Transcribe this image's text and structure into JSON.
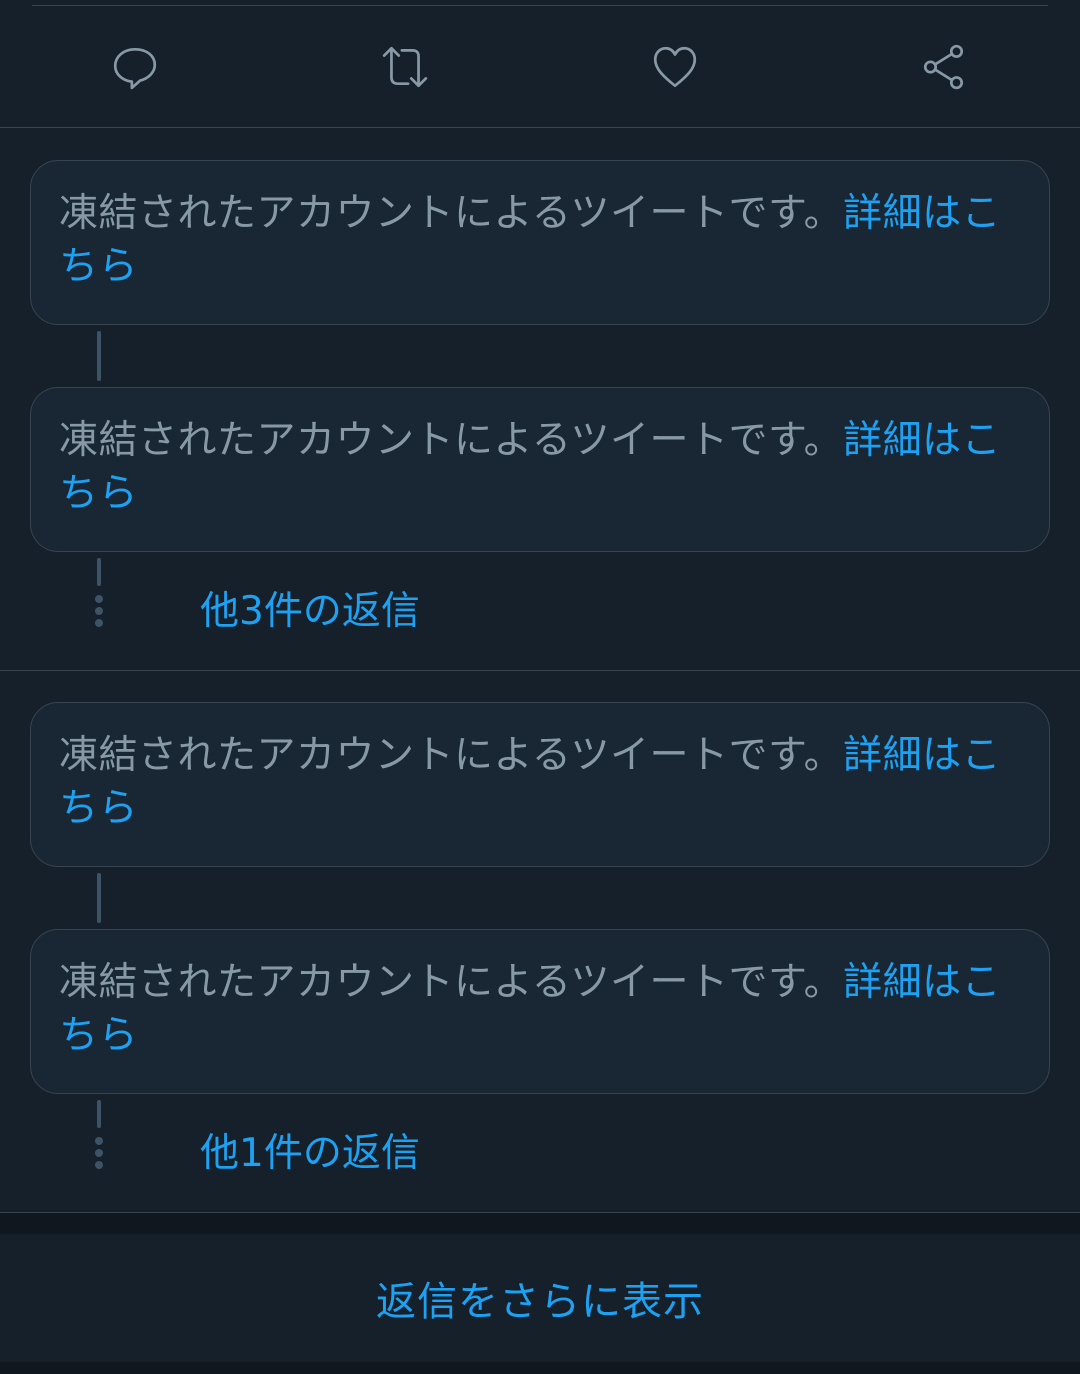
{
  "actions": {
    "reply_icon": "speech-bubble-icon",
    "retweet_icon": "retweet-icon",
    "like_icon": "heart-icon",
    "share_icon": "share-icon"
  },
  "threads": [
    {
      "replies": [
        {
          "message": "凍結されたアカウントによるツイートです。",
          "link": "詳細はこちら"
        },
        {
          "message": "凍結されたアカウントによるツイートです。",
          "link": "詳細はこちら"
        }
      ],
      "more_label": "他3件の返信"
    },
    {
      "replies": [
        {
          "message": "凍結されたアカウントによるツイートです。",
          "link": "詳細はこちら"
        },
        {
          "message": "凍結されたアカウントによるツイートです。",
          "link": "詳細はこちら"
        }
      ],
      "more_label": "他1件の返信"
    }
  ],
  "show_more_label": "返信をさらに表示",
  "colors": {
    "background": "#15202b",
    "card": "#192734",
    "border": "#38444d",
    "text_secondary": "#8899a6",
    "accent": "#1da1f2"
  }
}
